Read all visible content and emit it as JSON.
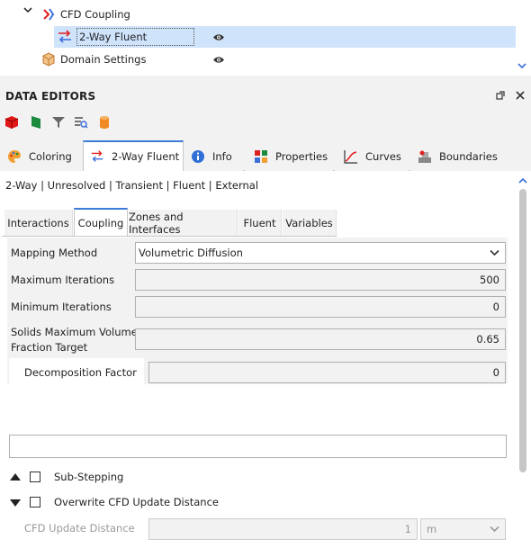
{
  "tree": {
    "items": [
      {
        "label": "CFD Coupling"
      },
      {
        "label": "2-Way Fluent"
      },
      {
        "label": "Domain Settings"
      }
    ]
  },
  "data_editors": {
    "title": "DATA EDITORS",
    "toolbar_icons": [
      "red-cube-icon",
      "green-flag-icon",
      "filter-icon",
      "search-list-icon",
      "cylinder-icon"
    ]
  },
  "tabs": [
    {
      "label": "Coloring",
      "icon": "palette-icon"
    },
    {
      "label": "2-Way Fluent",
      "icon": "coupling-arrows-icon"
    },
    {
      "label": "Info",
      "icon": "info-icon"
    },
    {
      "label": "Properties",
      "icon": "properties-grid-icon"
    },
    {
      "label": "Curves",
      "icon": "curve-chart-icon"
    },
    {
      "label": "Boundaries",
      "icon": "boundaries-icon"
    }
  ],
  "summary": "2-Way | Unresolved | Transient | Fluent | External",
  "subtabs": [
    {
      "label": "Interactions"
    },
    {
      "label": "Coupling"
    },
    {
      "label": "Zones and Interfaces"
    },
    {
      "label": "Fluent"
    },
    {
      "label": "Variables"
    }
  ],
  "form": {
    "mapping_method": {
      "label": "Mapping Method",
      "value": "Volumetric Diffusion"
    },
    "max_iterations": {
      "label": "Maximum Iterations",
      "value": "500"
    },
    "min_iterations": {
      "label": "Minimum Iterations",
      "value": "0"
    },
    "solids_max_line1": "Solids Maximum Volume",
    "solids_max_line2": "Fraction Target",
    "solids_max_value": "0.65",
    "decomposition": {
      "label": "Decomposition Factor",
      "value": "0"
    }
  },
  "sub_stepping": {
    "label": "Sub-Stepping",
    "checked": false
  },
  "overwrite": {
    "label": "Overwrite CFD Update Distance",
    "checked": false
  },
  "cfd_update_distance": {
    "label": "CFD Update Distance",
    "value": "1",
    "unit": "m"
  },
  "colors": {
    "accent": "#3d7bd9",
    "selection": "#cfe3fb"
  }
}
